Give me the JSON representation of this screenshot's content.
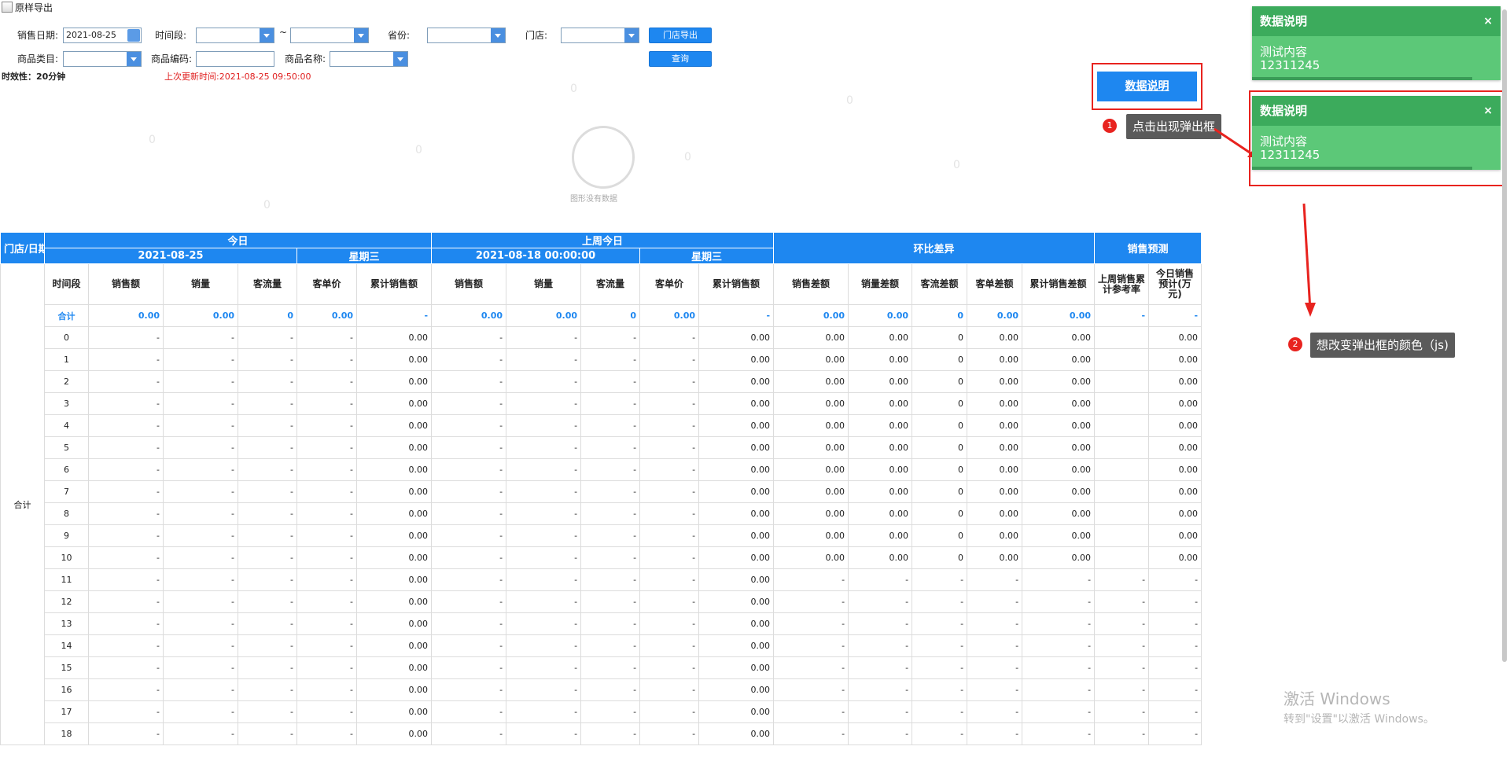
{
  "window": {
    "title": "原样导出"
  },
  "filters": {
    "sales_date_label": "销售日期:",
    "sales_date_value": "2021-08-25",
    "time_period_label": "时间段:",
    "range_sep": "~",
    "province_label": "省份:",
    "store_label": "门店:",
    "store_export_label": "门店导出",
    "category_label": "商品类目:",
    "code_label": "商品编码:",
    "name_label": "商品名称:",
    "query_label": "查询"
  },
  "info": {
    "timeliness": "时效性：20分钟",
    "last_update": "上次更新时间:2021-08-25 09:50:00"
  },
  "chart_placeholder": {
    "text": "图形没有数据"
  },
  "data_button": {
    "label": "数据说明"
  },
  "annotations": {
    "a1": {
      "num": "1",
      "text": "点击出现弹出框"
    },
    "a2": {
      "num": "2",
      "text": "想改变弹出框的颜色（js)"
    }
  },
  "popups": [
    {
      "title": "数据说明",
      "close": "×",
      "line1": "测试内容",
      "line2": "12311245"
    },
    {
      "title": "数据说明",
      "close": "×",
      "line1": "测试内容",
      "line2": "12311245"
    }
  ],
  "watermark": {
    "glyph": "0"
  },
  "windows_activation": {
    "line1": "激活 Windows",
    "line2": "转到\"设置\"以激活 Windows。"
  },
  "table": {
    "header_top": [
      "门店/日期",
      "今日",
      "上周今日",
      "环比差异",
      "销售预测"
    ],
    "today_date": "2021-08-25",
    "today_week": "星期三",
    "lastweek_date": "2021-08-18 00:00:00",
    "lastweek_week": "星期三",
    "store_cell": "合计",
    "subheaders": [
      "时间段",
      "销售额",
      "销量",
      "客流量",
      "客单价",
      "累计销售额",
      "销售额",
      "销量",
      "客流量",
      "客单价",
      "累计销售额",
      "销售差额",
      "销量差额",
      "客流差额",
      "客单差额",
      "累计销售差额",
      "上周销售累计参考率",
      "今日销售预计(万元)"
    ],
    "sum_row": [
      "合计",
      "0.00",
      "0.00",
      "0",
      "0.00",
      "-",
      "0.00",
      "0.00",
      "0",
      "0.00",
      "-",
      "0.00",
      "0.00",
      "0",
      "0.00",
      "0.00",
      "-",
      "-"
    ],
    "rows": [
      [
        "0",
        "-",
        "-",
        "-",
        "-",
        "0.00",
        "-",
        "-",
        "-",
        "-",
        "0.00",
        "0.00",
        "0.00",
        "0",
        "0.00",
        "0.00",
        "",
        "0.00"
      ],
      [
        "1",
        "-",
        "-",
        "-",
        "-",
        "0.00",
        "-",
        "-",
        "-",
        "-",
        "0.00",
        "0.00",
        "0.00",
        "0",
        "0.00",
        "0.00",
        "",
        "0.00"
      ],
      [
        "2",
        "-",
        "-",
        "-",
        "-",
        "0.00",
        "-",
        "-",
        "-",
        "-",
        "0.00",
        "0.00",
        "0.00",
        "0",
        "0.00",
        "0.00",
        "",
        "0.00"
      ],
      [
        "3",
        "-",
        "-",
        "-",
        "-",
        "0.00",
        "-",
        "-",
        "-",
        "-",
        "0.00",
        "0.00",
        "0.00",
        "0",
        "0.00",
        "0.00",
        "",
        "0.00"
      ],
      [
        "4",
        "-",
        "-",
        "-",
        "-",
        "0.00",
        "-",
        "-",
        "-",
        "-",
        "0.00",
        "0.00",
        "0.00",
        "0",
        "0.00",
        "0.00",
        "",
        "0.00"
      ],
      [
        "5",
        "-",
        "-",
        "-",
        "-",
        "0.00",
        "-",
        "-",
        "-",
        "-",
        "0.00",
        "0.00",
        "0.00",
        "0",
        "0.00",
        "0.00",
        "",
        "0.00"
      ],
      [
        "6",
        "-",
        "-",
        "-",
        "-",
        "0.00",
        "-",
        "-",
        "-",
        "-",
        "0.00",
        "0.00",
        "0.00",
        "0",
        "0.00",
        "0.00",
        "",
        "0.00"
      ],
      [
        "7",
        "-",
        "-",
        "-",
        "-",
        "0.00",
        "-",
        "-",
        "-",
        "-",
        "0.00",
        "0.00",
        "0.00",
        "0",
        "0.00",
        "0.00",
        "",
        "0.00"
      ],
      [
        "8",
        "-",
        "-",
        "-",
        "-",
        "0.00",
        "-",
        "-",
        "-",
        "-",
        "0.00",
        "0.00",
        "0.00",
        "0",
        "0.00",
        "0.00",
        "",
        "0.00"
      ],
      [
        "9",
        "-",
        "-",
        "-",
        "-",
        "0.00",
        "-",
        "-",
        "-",
        "-",
        "0.00",
        "0.00",
        "0.00",
        "0",
        "0.00",
        "0.00",
        "",
        "0.00"
      ],
      [
        "10",
        "-",
        "-",
        "-",
        "-",
        "0.00",
        "-",
        "-",
        "-",
        "-",
        "0.00",
        "0.00",
        "0.00",
        "0",
        "0.00",
        "0.00",
        "",
        "0.00"
      ],
      [
        "11",
        "-",
        "-",
        "-",
        "-",
        "0.00",
        "-",
        "-",
        "-",
        "-",
        "0.00",
        "-",
        "-",
        "-",
        "-",
        "-",
        "-",
        "-"
      ],
      [
        "12",
        "-",
        "-",
        "-",
        "-",
        "0.00",
        "-",
        "-",
        "-",
        "-",
        "0.00",
        "-",
        "-",
        "-",
        "-",
        "-",
        "-",
        "-"
      ],
      [
        "13",
        "-",
        "-",
        "-",
        "-",
        "0.00",
        "-",
        "-",
        "-",
        "-",
        "0.00",
        "-",
        "-",
        "-",
        "-",
        "-",
        "-",
        "-"
      ],
      [
        "14",
        "-",
        "-",
        "-",
        "-",
        "0.00",
        "-",
        "-",
        "-",
        "-",
        "0.00",
        "-",
        "-",
        "-",
        "-",
        "-",
        "-",
        "-"
      ],
      [
        "15",
        "-",
        "-",
        "-",
        "-",
        "0.00",
        "-",
        "-",
        "-",
        "-",
        "0.00",
        "-",
        "-",
        "-",
        "-",
        "-",
        "-",
        "-"
      ],
      [
        "16",
        "-",
        "-",
        "-",
        "-",
        "0.00",
        "-",
        "-",
        "-",
        "-",
        "0.00",
        "-",
        "-",
        "-",
        "-",
        "-",
        "-",
        "-"
      ],
      [
        "17",
        "-",
        "-",
        "-",
        "-",
        "0.00",
        "-",
        "-",
        "-",
        "-",
        "0.00",
        "-",
        "-",
        "-",
        "-",
        "-",
        "-",
        "-"
      ],
      [
        "18",
        "-",
        "-",
        "-",
        "-",
        "0.00",
        "-",
        "-",
        "-",
        "-",
        "0.00",
        "-",
        "-",
        "-",
        "-",
        "-",
        "-",
        "-"
      ]
    ]
  }
}
